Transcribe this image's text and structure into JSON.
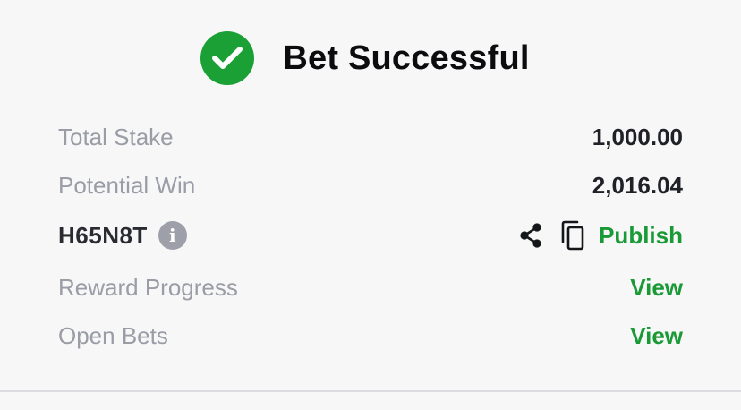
{
  "header": {
    "title": "Bet Successful",
    "icon": "check-circle-icon"
  },
  "summary": {
    "total_stake_label": "Total Stake",
    "total_stake_value": "1,000.00",
    "potential_win_label": "Potential Win",
    "potential_win_value": "2,016.04",
    "booking_code": "H65N8T",
    "info_icon_glyph": "i",
    "publish_label": "Publish",
    "reward_progress_label": "Reward Progress",
    "reward_progress_link": "View",
    "open_bets_label": "Open Bets",
    "open_bets_link": "View"
  },
  "icons": {
    "share": "share-icon",
    "copy": "copy-icon",
    "info": "info-icon"
  },
  "colors": {
    "accent_green": "#1a9a36",
    "success_green": "#1aa034",
    "label_gray": "#9a9ca6",
    "background": "#f7f7f8"
  }
}
